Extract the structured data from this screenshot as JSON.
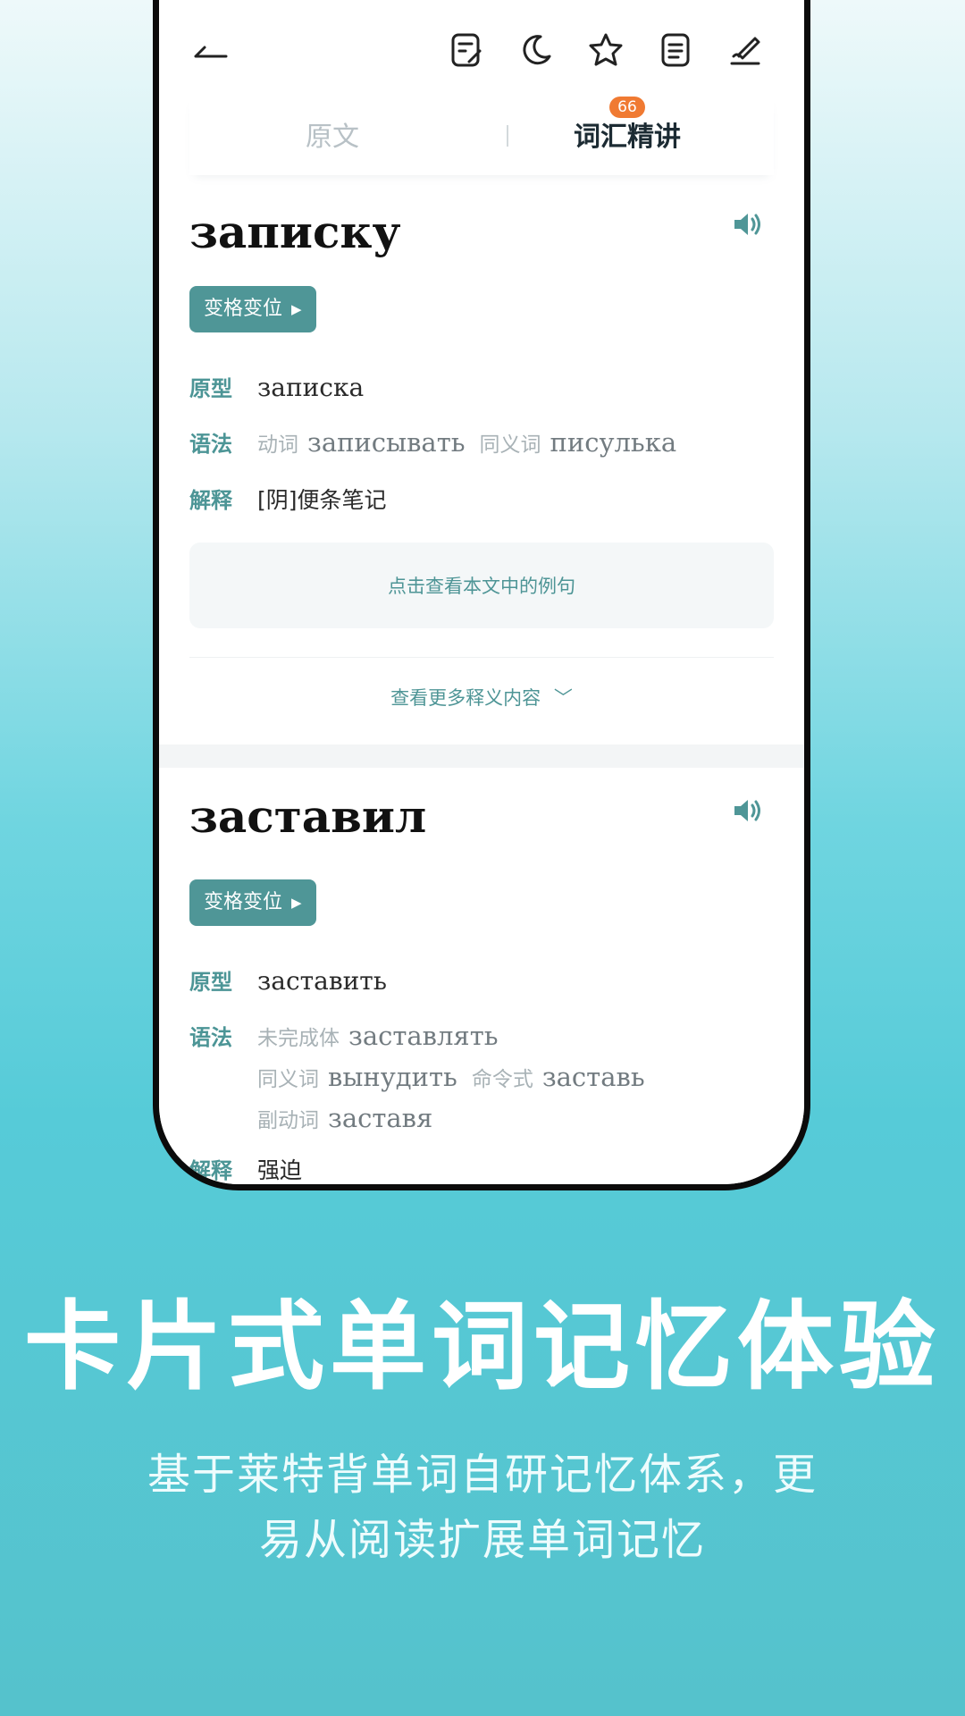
{
  "app": {
    "tabs": {
      "original": "原文",
      "vocab": "词汇精讲",
      "vocab_badge": "66"
    },
    "toolbar_icons": [
      "back-arrow-icon",
      "edit-note-icon",
      "moon-icon",
      "star-icon",
      "document-icon",
      "pen-sign-icon"
    ]
  },
  "labels": {
    "inflection": "变格变位",
    "lemma": "原型",
    "grammar": "语法",
    "definition": "解释",
    "examples": "点击查看本文中的例句",
    "more": "查看更多释义内容"
  },
  "words": [
    {
      "word": "записку",
      "lemma": "записка",
      "grammar": [
        {
          "tag": "动词",
          "value": "записывать"
        },
        {
          "tag": "同义词",
          "value": "писулька"
        }
      ],
      "definition": "[阴]便条笔记"
    },
    {
      "word": "заставил",
      "lemma": "заставить",
      "grammar": [
        {
          "tag": "未完成体",
          "value": "заставлять"
        },
        {
          "tag": "同义词",
          "value": "вынудить"
        },
        {
          "tag": "命令式",
          "value": "заставь"
        },
        {
          "tag": "副动词",
          "value": "заставя"
        }
      ],
      "definition": "强迫"
    }
  ],
  "promo": {
    "headline": "卡片式单词记忆体验",
    "sub_line1": "基于莱特背单词自研记忆体系，更",
    "sub_line2": "易从阅读扩展单词记忆"
  },
  "colors": {
    "accent": "#4f9697",
    "badge": "#f07a32",
    "background_top": "#eef9fa",
    "background_bottom": "#55c2cc"
  }
}
